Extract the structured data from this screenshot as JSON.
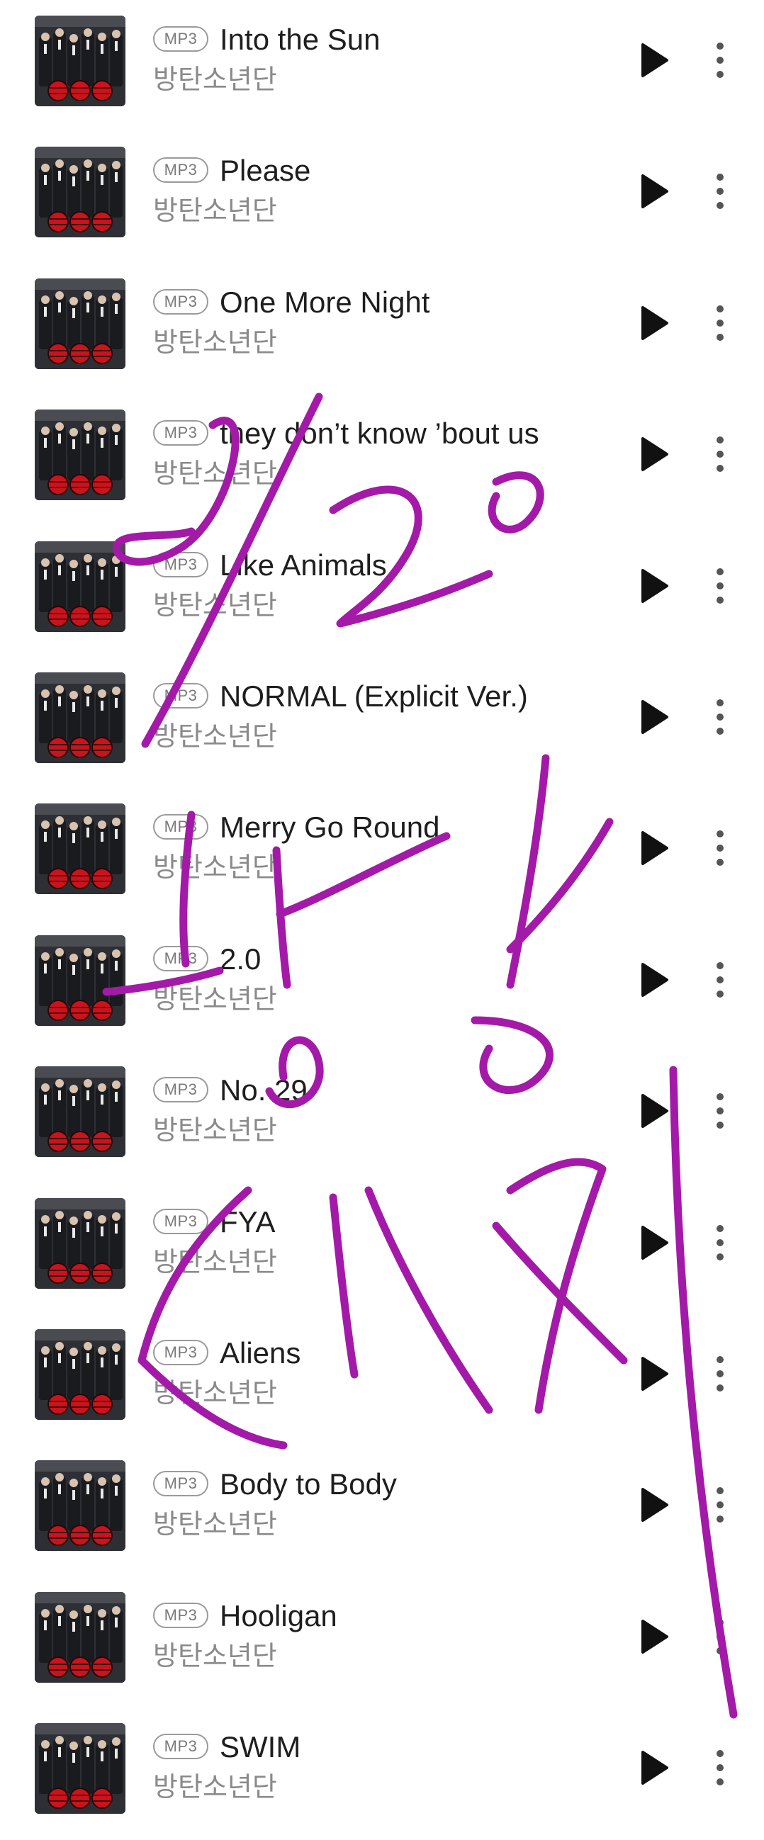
{
  "list": {
    "badge_label": "MP3",
    "songs": [
      {
        "title": "Into the Sun",
        "artist": "방탄소년단"
      },
      {
        "title": "Please",
        "artist": "방탄소년단"
      },
      {
        "title": "One More Night",
        "artist": "방탄소년단"
      },
      {
        "title": "they don’t know ’bout us",
        "artist": "방탄소년단"
      },
      {
        "title": "Like Animals",
        "artist": "방탄소년단"
      },
      {
        "title": "NORMAL (Explicit Ver.)",
        "artist": "방탄소년단"
      },
      {
        "title": "Merry Go Round",
        "artist": "방탄소년단"
      },
      {
        "title": "2.0",
        "artist": "방탄소년단"
      },
      {
        "title": "No. 29",
        "artist": "방탄소년단"
      },
      {
        "title": "FYA",
        "artist": "방탄소년단"
      },
      {
        "title": "Aliens",
        "artist": "방탄소년단"
      },
      {
        "title": "Body to Body",
        "artist": "방탄소년단"
      },
      {
        "title": "Hooligan",
        "artist": "방탄소년단"
      },
      {
        "title": "SWIM",
        "artist": "방탄소년단"
      }
    ]
  },
  "icons": {
    "play": "play-icon",
    "more": "more-vertical-icon",
    "album_art": "album-art-thumbnail"
  },
  "annotation": {
    "type": "handwritten-scribble",
    "color": "#a31aa8"
  },
  "colors": {
    "title_text": "#1e1e1e",
    "artist_text": "#8a8a8a",
    "badge_border": "#9a9a9a",
    "play_icon": "#111111",
    "more_icon": "#555555"
  }
}
